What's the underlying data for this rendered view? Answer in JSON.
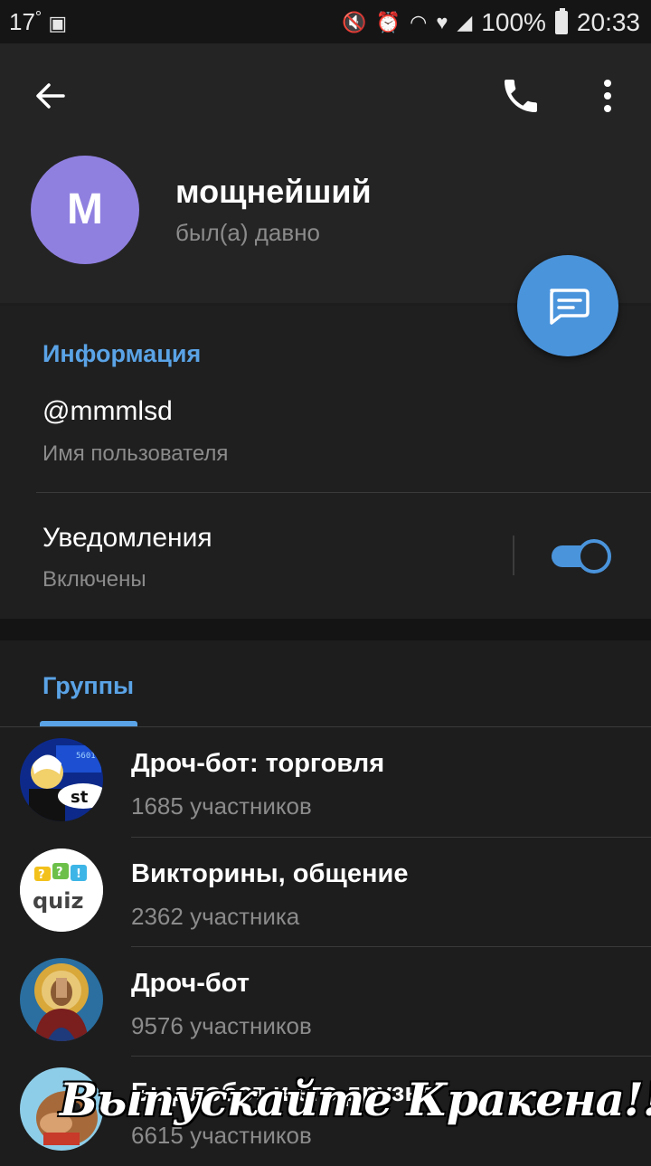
{
  "status_bar": {
    "temperature": "17",
    "temperature_unit": "°",
    "battery": "100%",
    "time": "20:33"
  },
  "profile": {
    "avatar_letter": "M",
    "name": "мощнейший",
    "last_seen": "был(а) давно"
  },
  "info": {
    "section_title": "Информация",
    "username": "@mmmlsd",
    "username_label": "Имя пользователя",
    "notifications_label": "Уведомления",
    "notifications_status": "Включены",
    "notifications_enabled": true
  },
  "groups": {
    "section_title": "Группы",
    "items": [
      {
        "title": "Дроч-бот: торговля",
        "subtitle": "1685 участников"
      },
      {
        "title": "Викторины, общение",
        "subtitle": "2362 участника"
      },
      {
        "title": "Дроч-бот",
        "subtitle": "9576 участников"
      },
      {
        "title": "Быдлобот и его друзья",
        "subtitle": "6615 участников"
      }
    ]
  },
  "overlay_caption": "Выпускайте Кракена!!!",
  "colors": {
    "accent": "#4a94dc",
    "section_title": "#5aa3e6",
    "avatar": "#8f80e0",
    "background": "#1d1d1d"
  },
  "icons": [
    "back-arrow-icon",
    "phone-icon",
    "more-vert-icon",
    "message-icon"
  ]
}
